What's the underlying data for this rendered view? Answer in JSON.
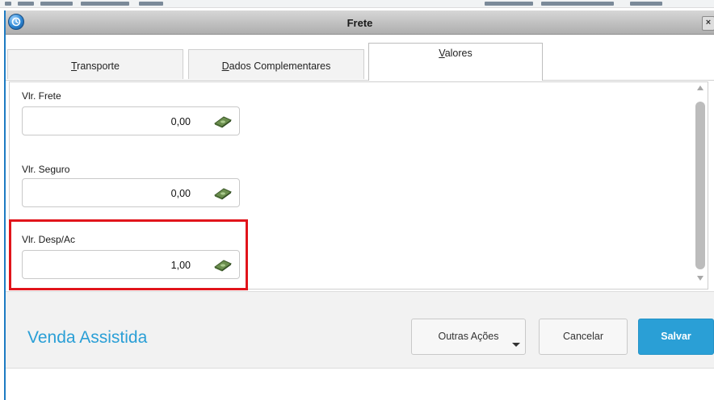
{
  "window": {
    "title": "Frete",
    "close_label": "×"
  },
  "tabs": [
    {
      "prefix": "",
      "mnemonic": "T",
      "rest": "ransporte",
      "active": false
    },
    {
      "prefix": "",
      "mnemonic": "D",
      "rest": "ados Complementares",
      "active": false
    },
    {
      "prefix": "",
      "mnemonic": "V",
      "rest": "alores",
      "active": true
    }
  ],
  "fields": [
    {
      "label": "Vlr. Frete",
      "value": "0,00",
      "icon": "money-icon"
    },
    {
      "label": "Vlr. Seguro",
      "value": "0,00",
      "icon": "money-icon"
    },
    {
      "label": "Vlr. Desp/Ac",
      "value": "1,00",
      "icon": "money-icon",
      "highlighted": true
    }
  ],
  "footer": {
    "brand": "Venda Assistida",
    "other_actions_label": "Outras Ações",
    "cancel_label": "Cancelar",
    "save_label": "Salvar"
  },
  "colors": {
    "accent": "#2a9fd6",
    "highlight_border": "#e1141b"
  }
}
